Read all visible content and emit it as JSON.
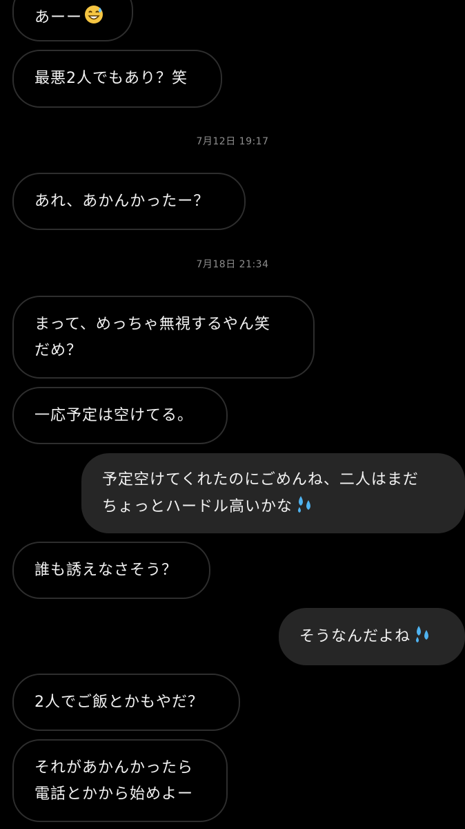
{
  "messages": {
    "m1": {
      "text": "あーー",
      "emoji": "grinning-sweat-icon"
    },
    "m2": {
      "text": "最悪2人でもあり？笑"
    },
    "ts1": "7月12日 19:17",
    "m3": {
      "text": "あれ、あかんかったー？"
    },
    "ts2": "7月18日 21:34",
    "m4": {
      "line1": "まって、めっちゃ無視するやん笑",
      "line2": "だめ？"
    },
    "m5": {
      "text": "一応予定は空けてる。"
    },
    "m6": {
      "line1": "予定空けてくれたのにごめんね、二人はまだ",
      "line2": "ちょっとハードル高いかな",
      "emoji": "sweat-droplets-icon"
    },
    "m7": {
      "text": "誰も誘えなさそう？"
    },
    "m8": {
      "text": "そうなんだよね",
      "emoji": "sweat-droplets-icon"
    },
    "m9": {
      "text": "2人でご飯とかもやだ？"
    },
    "m10": {
      "line1": "それがあかんかったら",
      "line2": "電話とかから始めよー"
    }
  },
  "colors": {
    "background": "#000000",
    "incoming_border": "#2e2e2e",
    "outgoing_bg": "#262626",
    "text": "#f2f2f2",
    "timestamp": "#8e8e8e"
  }
}
